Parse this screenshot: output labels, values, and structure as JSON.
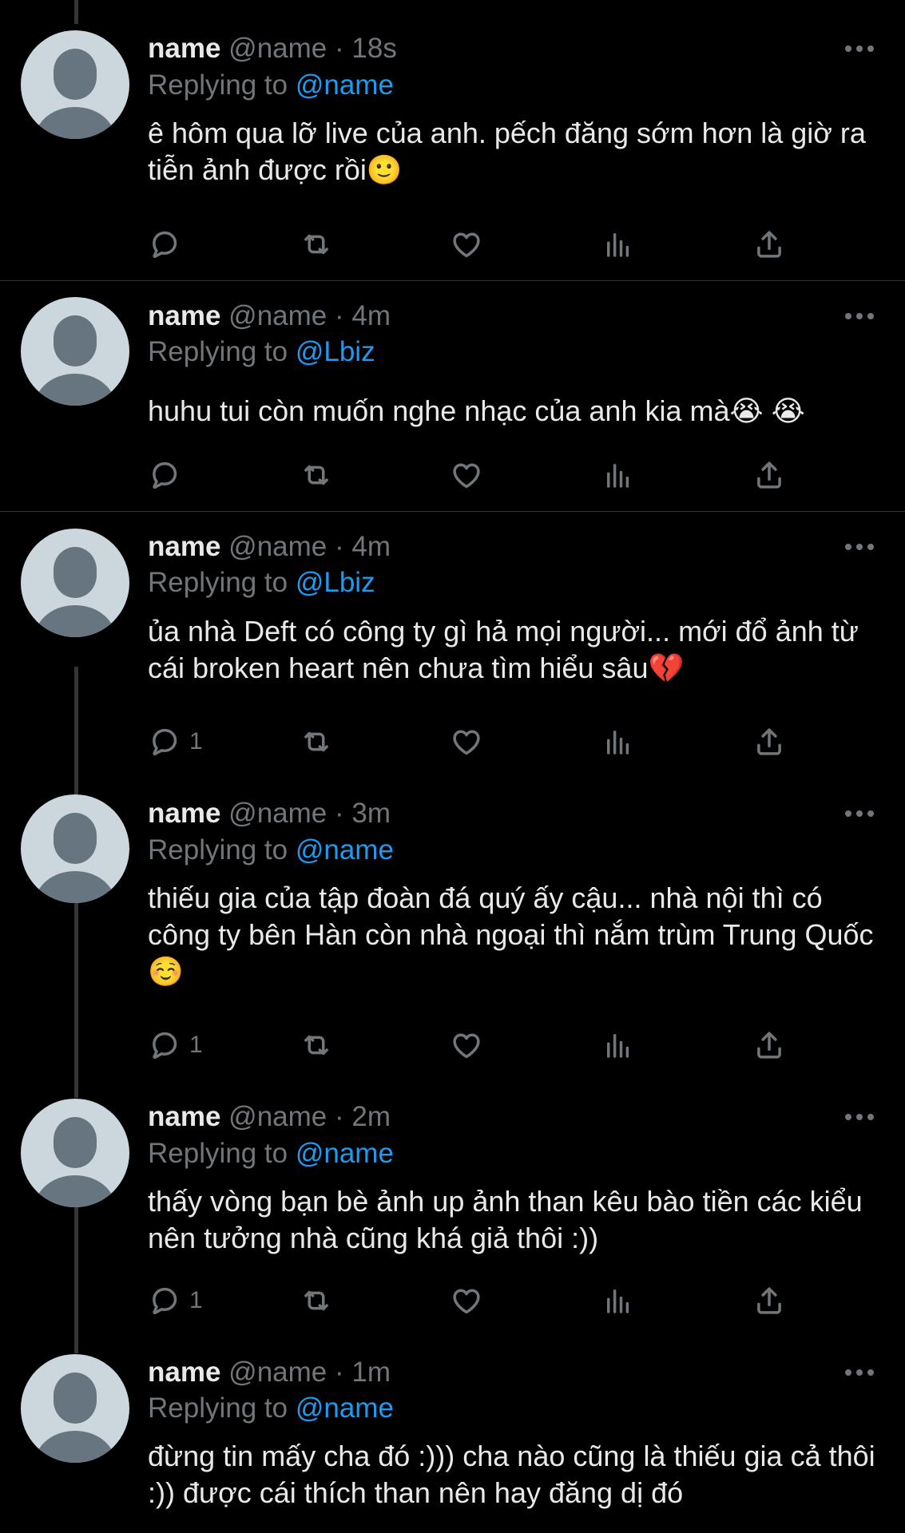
{
  "colors": {
    "background": "#000000",
    "text": "#e7e9ea",
    "muted": "#71767b",
    "link": "#1d9bf0",
    "divider": "#2f3336"
  },
  "icons": {
    "reply": "speech-bubble-icon",
    "retweet": "retweet-arrows-icon",
    "like": "heart-outline-icon",
    "views": "bar-chart-icon",
    "share": "share-upload-icon",
    "more": "three-dots-icon"
  },
  "tweets": [
    {
      "display_name": "name",
      "handle": "@name",
      "sep": "·",
      "time": "18s",
      "replying_label": "Replying to",
      "replying_to": "@name",
      "text": "ê hôm qua lỡ live của anh. pếch đăng sớm hơn là giờ ra tiễn ảnh được rồi🙂",
      "reply_count": ""
    },
    {
      "display_name": "name",
      "handle": "@name",
      "sep": "·",
      "time": "4m",
      "replying_label": "Replying to",
      "replying_to": "@Lbiz",
      "text": "huhu tui còn muốn nghe nhạc của anh kia mà😭 😭",
      "reply_count": ""
    },
    {
      "display_name": "name",
      "handle": "@name",
      "sep": "·",
      "time": "4m",
      "replying_label": "Replying to",
      "replying_to": "@Lbiz",
      "text": "ủa nhà Deft có công ty gì hả mọi người... mới đổ ảnh từ cái broken heart nên chưa tìm hiểu sâu💔",
      "reply_count": "1"
    },
    {
      "display_name": "name",
      "handle": "@name",
      "sep": "·",
      "time": "3m",
      "replying_label": "Replying to",
      "replying_to": "@name",
      "text": "thiếu gia của tập đoàn đá quý ấy cậu... nhà nội thì có công ty bên Hàn còn nhà ngoại thì nắm trùm Trung Quốc☺️",
      "reply_count": "1"
    },
    {
      "display_name": "name",
      "handle": "@name",
      "sep": "·",
      "time": "2m",
      "replying_label": "Replying to",
      "replying_to": "@name",
      "text": "thấy vòng bạn bè ảnh up ảnh than kêu bào tiền các kiểu nên tưởng nhà cũng khá giả thôi :))",
      "reply_count": "1"
    },
    {
      "display_name": "name",
      "handle": "@name",
      "sep": "·",
      "time": "1m",
      "replying_label": "Replying to",
      "replying_to": "@name",
      "text": "đừng tin mấy cha đó :))) cha nào cũng là thiếu gia cả thôi :)) được cái thích than nên hay đăng dị đó",
      "reply_count": ""
    }
  ]
}
